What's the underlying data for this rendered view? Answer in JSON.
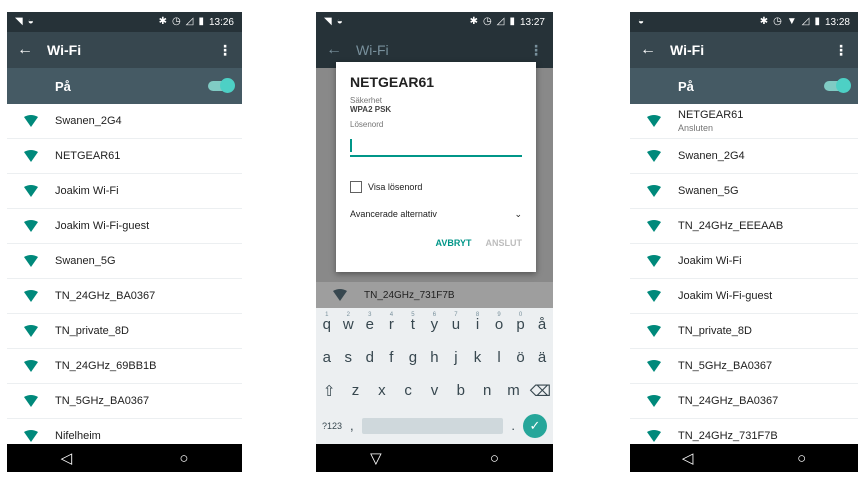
{
  "colors": {
    "statusbar": "#263238",
    "appbar": "#37474f",
    "switchbar": "#455a64",
    "accent": "#009688",
    "wifi": "#00897b"
  },
  "screens": [
    {
      "status_time": "13:26",
      "title": "Wi-Fi",
      "switch_label": "På",
      "networks": [
        {
          "name": "Swanen_2G4"
        },
        {
          "name": "NETGEAR61"
        },
        {
          "name": "Joakim Wi-Fi"
        },
        {
          "name": "Joakim Wi-Fi-guest"
        },
        {
          "name": "Swanen_5G"
        },
        {
          "name": "TN_24GHz_BA0367"
        },
        {
          "name": "TN_private_8D"
        },
        {
          "name": "TN_24GHz_69BB1B"
        },
        {
          "name": "TN_5GHz_BA0367"
        },
        {
          "name": "Nifelheim"
        }
      ]
    },
    {
      "status_time": "13:27",
      "title": "Wi-Fi",
      "dialog": {
        "title": "NETGEAR61",
        "security_label": "Säkerhet",
        "security_value": "WPA2 PSK",
        "password_label": "Lösenord",
        "show_password": "Visa lösenord",
        "advanced": "Avancerade alternativ",
        "cancel": "AVBRYT",
        "connect": "ANSLUT"
      },
      "peek_network": "TN_24GHz_731F7B",
      "keyboard": {
        "row1": [
          "q",
          "w",
          "e",
          "r",
          "t",
          "y",
          "u",
          "i",
          "o",
          "p",
          "å"
        ],
        "row1_hints": [
          "1",
          "2",
          "3",
          "4",
          "5",
          "6",
          "7",
          "8",
          "9",
          "0",
          ""
        ],
        "row2": [
          "a",
          "s",
          "d",
          "f",
          "g",
          "h",
          "j",
          "k",
          "l",
          "ö",
          "ä"
        ],
        "row3": [
          "z",
          "x",
          "c",
          "v",
          "b",
          "n",
          "m"
        ],
        "symbols": "?123",
        "comma": ",",
        "period": "."
      }
    },
    {
      "status_time": "13:28",
      "title": "Wi-Fi",
      "switch_label": "På",
      "networks": [
        {
          "name": "NETGEAR61",
          "sub": "Ansluten"
        },
        {
          "name": "Swanen_2G4"
        },
        {
          "name": "Swanen_5G"
        },
        {
          "name": "TN_24GHz_EEEAAB"
        },
        {
          "name": "Joakim Wi-Fi"
        },
        {
          "name": "Joakim Wi-Fi-guest"
        },
        {
          "name": "TN_private_8D"
        },
        {
          "name": "TN_5GHz_BA0367"
        },
        {
          "name": "TN_24GHz_BA0367"
        },
        {
          "name": "TN_24GHz_731F7B"
        }
      ]
    }
  ]
}
